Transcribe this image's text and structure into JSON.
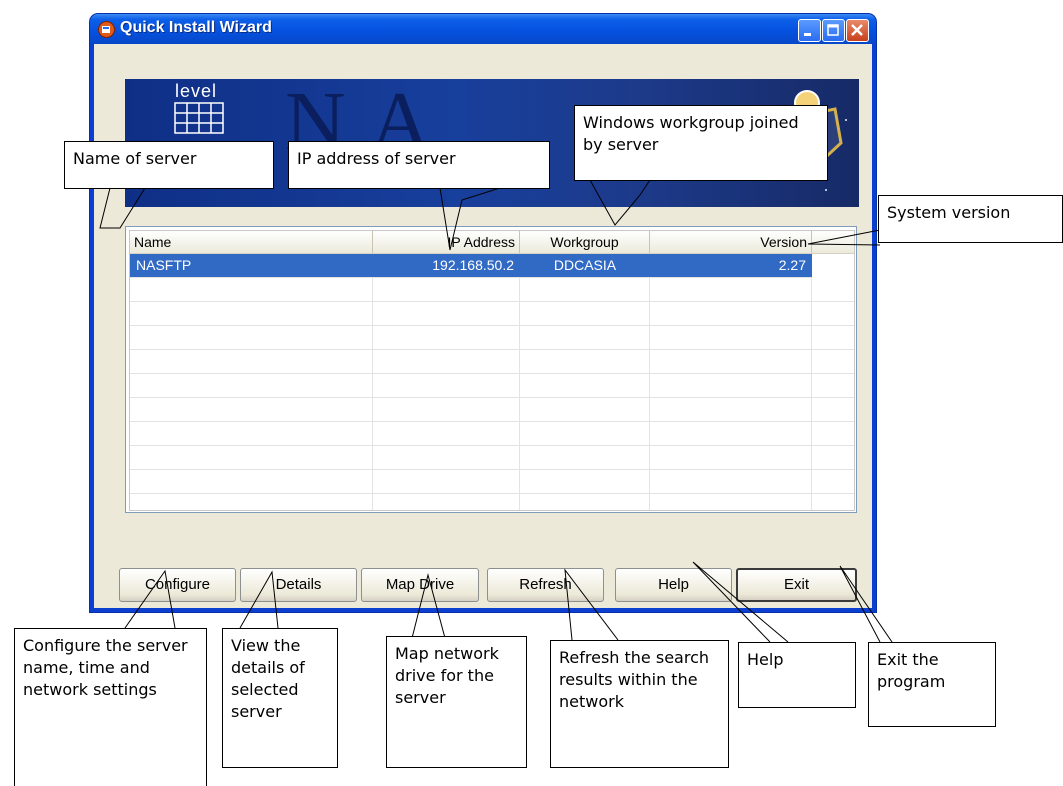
{
  "window": {
    "title": "Quick Install Wizard",
    "controls": [
      "minimize",
      "maximize",
      "close"
    ]
  },
  "banner": {
    "logo_text": "level",
    "big_text": "N  A"
  },
  "list": {
    "columns": [
      "Name",
      "IP Address",
      "Workgroup",
      "Version"
    ],
    "rows": [
      {
        "name": "NASFTP",
        "ip": "192.168.50.2",
        "workgroup": "DDCASIA",
        "version": "2.27",
        "selected": true
      }
    ]
  },
  "buttons": {
    "configure": "Configure",
    "details": "Details",
    "map_drive": "Map Drive",
    "refresh": "Refresh",
    "help": "Help",
    "exit": "Exit"
  },
  "callouts": {
    "name": "Name of server",
    "ip": "IP address of server",
    "workgroup": "Windows workgroup joined by server",
    "version": "System version",
    "configure": "Configure the server name, time and network settings",
    "details": "View the details of selected server",
    "map": "Map network drive for the server",
    "refresh": "Refresh the search results within the network",
    "help": "Help",
    "exit": "Exit the program"
  },
  "colors": {
    "titlebar": "#0552e0",
    "selection": "#316ac5",
    "client": "#ece9d8"
  }
}
